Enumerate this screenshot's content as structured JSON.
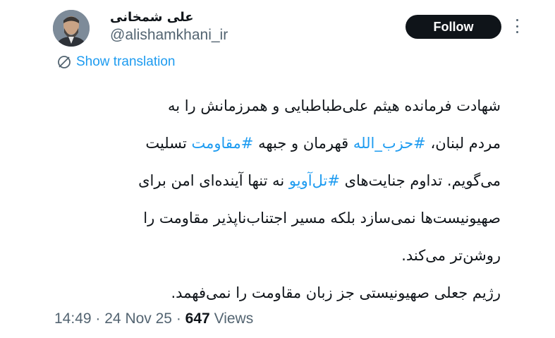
{
  "author": {
    "display_name": "علی شمخانی",
    "handle": "@alishamkhani_ir"
  },
  "follow_button": {
    "label": "Follow"
  },
  "more_icon": "three-dots-vertical",
  "translate": {
    "icon": "translate-slash-icon",
    "label": "Show translation"
  },
  "tweet": {
    "lines": [
      [
        {
          "text": "شهادت فرمانده هیثم علی‌طباطبایی و همرزمانش را به"
        }
      ],
      [
        {
          "text": "مردم لبنان، "
        },
        {
          "text": "#حزب_الله",
          "hashtag": true
        },
        {
          "text": " قهرمان و جبهه "
        },
        {
          "text": "#مقاومت",
          "hashtag": true
        },
        {
          "text": " تسلیت"
        }
      ],
      [
        {
          "text": "می‌گویم. تداوم جنایت‌های "
        },
        {
          "text": "#تل‌آویو",
          "hashtag": true
        },
        {
          "text": " نه تنها آینده‌ای امن برای"
        }
      ],
      [
        {
          "text": "صهیونیست‌ها نمی‌سازد بلکه مسیر اجتناب‌ناپذیر مقاومت را"
        }
      ],
      [
        {
          "text": "روشن‌تر می‌کند."
        }
      ],
      [
        {
          "text": "رژیم جعلی صهیونیستی جز زبان مقاومت را نمی‌فهمد."
        }
      ]
    ]
  },
  "meta": {
    "time": "14:49",
    "date": "24 Nov 25",
    "views_count": "647",
    "views_label": "Views",
    "separator": "·"
  },
  "colors": {
    "link": "#1d9bf0",
    "text": "#0f1419",
    "secondary": "#536471",
    "button_bg": "#0f1419"
  }
}
